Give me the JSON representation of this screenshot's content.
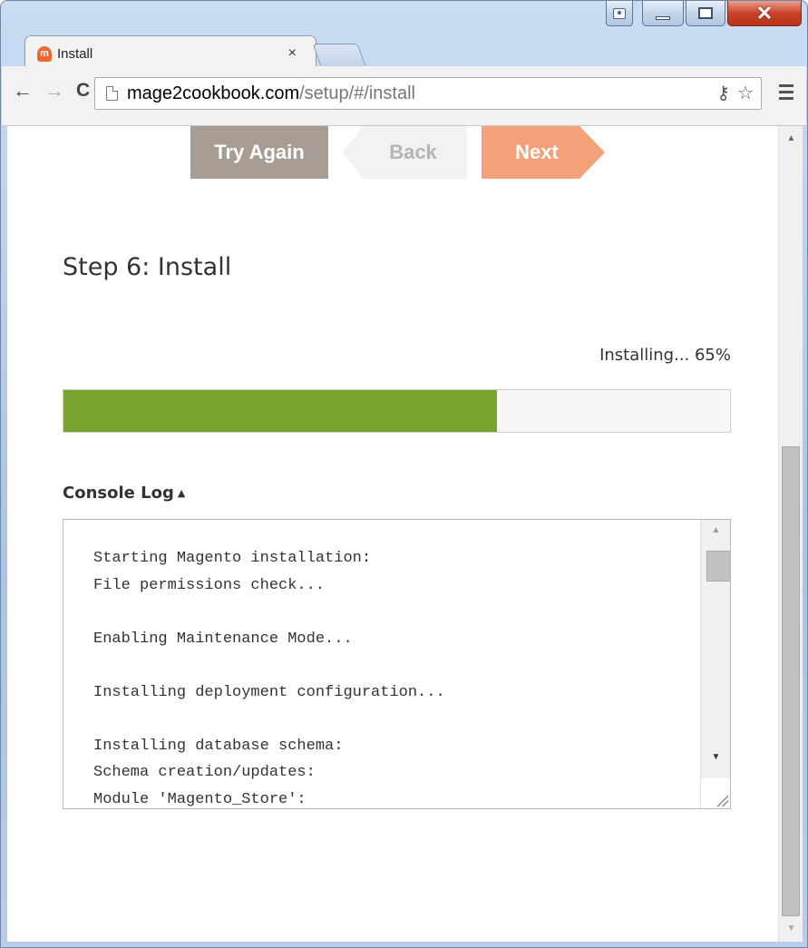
{
  "browser": {
    "tab_title": "Install",
    "tab_close": "×",
    "url_host": "mage2cookbook.com",
    "url_path": "/setup/#/install",
    "icons": {
      "favicon": "magento-logo-icon",
      "back": "arrow-left-icon",
      "forward": "arrow-right-icon",
      "reload": "reload-icon",
      "page": "page-icon",
      "key": "key-icon",
      "star": "star-icon",
      "menu": "hamburger-menu-icon",
      "user": "user-icon",
      "minimize": "minimize-icon",
      "maximize": "maximize-icon",
      "close": "close-icon"
    }
  },
  "page": {
    "buttons": {
      "try_again": "Try Again",
      "back": "Back",
      "next": "Next"
    },
    "step_title": "Step 6: Install",
    "progress": {
      "label": "Installing... 65%",
      "percent": 65,
      "fill_color": "#79a22e"
    },
    "console": {
      "title": "Console Log",
      "caret": "▲",
      "lines": [
        "Starting Magento installation:",
        "File permissions check...",
        "",
        "Enabling Maintenance Mode...",
        "",
        "Installing deployment configuration...",
        "",
        "Installing database schema:",
        "Schema creation/updates:",
        "Module 'Magento_Store':"
      ]
    }
  },
  "colors": {
    "try_again_bg": "#a79d95",
    "next_bg": "#f4a17a",
    "back_bg": "#f2f2f2"
  }
}
